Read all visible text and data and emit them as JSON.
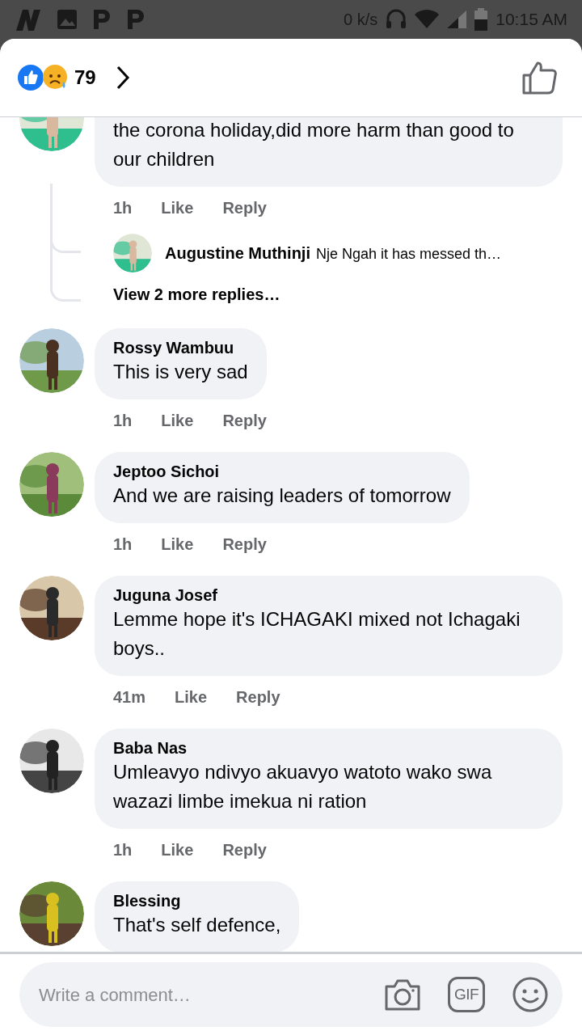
{
  "status_bar": {
    "speed": "0 k/s",
    "time": "10:15 AM"
  },
  "header": {
    "reaction_count": "79"
  },
  "comments": [
    {
      "text": "the corona holiday,did more harm than good to our children",
      "time": "1h",
      "like": "Like",
      "reply": "Reply",
      "replies": [
        {
          "name": "Augustine Muthinji",
          "text": "Nje Ngah it has messed th…"
        }
      ],
      "more_replies": "View 2 more replies…"
    },
    {
      "name": "Rossy Wambuu",
      "text": "This is very sad",
      "time": "1h",
      "like": "Like",
      "reply": "Reply"
    },
    {
      "name": "Jeptoo Sichoi",
      "text": "And we are raising leaders of tomorrow",
      "time": "1h",
      "like": "Like",
      "reply": "Reply"
    },
    {
      "name": "Juguna Josef",
      "text": "Lemme hope it's ICHAGAKI mixed not Ichagaki boys..",
      "time": "41m",
      "like": "Like",
      "reply": "Reply"
    },
    {
      "name": "Baba Nas",
      "text": "Umleavyo ndivyo akuavyo watoto wako swa wazazi limbe imekua ni ration",
      "time": "1h",
      "like": "Like",
      "reply": "Reply"
    },
    {
      "name": "Blessing",
      "text": "That's self defence,"
    }
  ],
  "composer": {
    "placeholder": "Write a comment…",
    "gif_label": "GIF"
  }
}
